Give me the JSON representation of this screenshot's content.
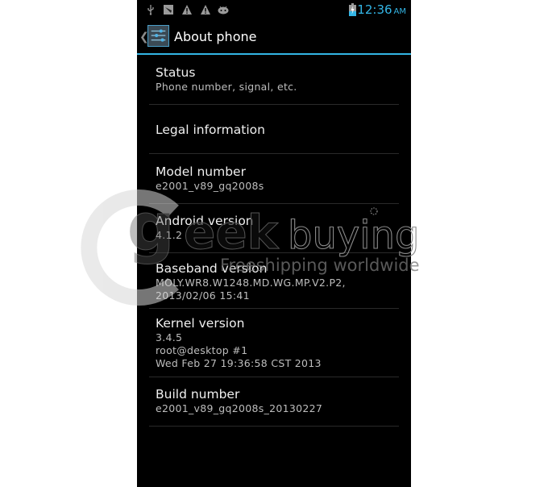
{
  "status_bar": {
    "icons_left": [
      "usb-icon",
      "download-icon",
      "warning-icon",
      "warning-icon",
      "android-icon"
    ],
    "time": "12:36",
    "ampm": "AM",
    "accent_color": "#33b5e5"
  },
  "action_bar": {
    "title": "About phone"
  },
  "items": [
    {
      "label": "Status",
      "sub": [
        "Phone number, signal, etc."
      ]
    },
    {
      "label": "Legal information",
      "sub": []
    },
    {
      "label": "Model number",
      "sub": [
        "e2001_v89_gq2008s"
      ]
    },
    {
      "label": "Android version",
      "sub": [
        "4.1.2"
      ]
    },
    {
      "label": "Baseband version",
      "sub": [
        "MOLY.WR8.W1248.MD.WG.MP.V2.P2,",
        "2013/02/06 15:41"
      ]
    },
    {
      "label": "Kernel version",
      "sub": [
        "3.4.5",
        "root@desktop #1",
        "Wed Feb 27 19:36:58 CST 2013"
      ]
    },
    {
      "label": "Build number",
      "sub": [
        "e2001_v89_gq2008s_20130227"
      ]
    }
  ],
  "watermark": {
    "brand": "geekbuying",
    "tagline": "Freeshipping worldwide"
  }
}
